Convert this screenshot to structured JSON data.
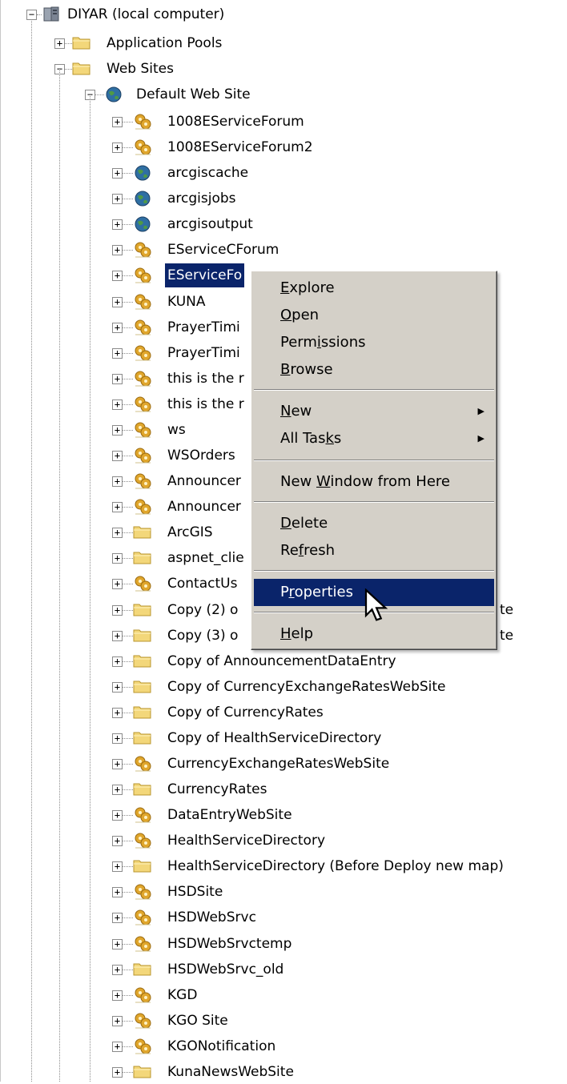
{
  "tree": {
    "root": {
      "label": "DIYAR (local computer)",
      "icon": "server-icon"
    },
    "app_pools": {
      "label": "Application Pools",
      "icon": "folder-icon"
    },
    "web_sites": {
      "label": "Web Sites",
      "icon": "folder-icon"
    },
    "default_site": {
      "label": "Default Web Site",
      "icon": "globe-icon"
    },
    "children": [
      {
        "label": "1008EServiceForum",
        "icon": "gear-icon"
      },
      {
        "label": "1008EServiceForum2",
        "icon": "gear-icon"
      },
      {
        "label": "arcgiscache",
        "icon": "globe-icon"
      },
      {
        "label": "arcgisjobs",
        "icon": "globe-icon"
      },
      {
        "label": "arcgisoutput",
        "icon": "globe-icon"
      },
      {
        "label": "EServiceCForum",
        "icon": "gear-icon"
      },
      {
        "label": "EServiceFo",
        "icon": "gear-icon",
        "selected": true
      },
      {
        "label": "KUNA",
        "icon": "gear-icon"
      },
      {
        "label": "PrayerTimi",
        "icon": "gear-icon"
      },
      {
        "label": "PrayerTimi",
        "icon": "gear-icon"
      },
      {
        "label": "this is the r",
        "icon": "gear-icon"
      },
      {
        "label": "this is the r",
        "icon": "gear-icon"
      },
      {
        "label": "ws",
        "icon": "gear-icon"
      },
      {
        "label": "WSOrders",
        "icon": "gear-icon"
      },
      {
        "label": "Announcer",
        "icon": "gear-icon"
      },
      {
        "label": "Announcer",
        "icon": "gear-icon"
      },
      {
        "label": "ArcGIS",
        "icon": "folder-icon"
      },
      {
        "label": "aspnet_clie",
        "icon": "folder-icon"
      },
      {
        "label": "ContactUs",
        "icon": "gear-icon"
      },
      {
        "label": "Copy (2) o",
        "icon": "folder-icon",
        "tail": "te"
      },
      {
        "label": "Copy (3) o",
        "icon": "folder-icon",
        "tail": "te"
      },
      {
        "label": "Copy of AnnouncementDataEntry",
        "icon": "folder-icon"
      },
      {
        "label": "Copy of CurrencyExchangeRatesWebSite",
        "icon": "folder-icon"
      },
      {
        "label": "Copy of CurrencyRates",
        "icon": "folder-icon"
      },
      {
        "label": "Copy of HealthServiceDirectory",
        "icon": "folder-icon"
      },
      {
        "label": "CurrencyExchangeRatesWebSite",
        "icon": "gear-icon"
      },
      {
        "label": "CurrencyRates",
        "icon": "folder-icon"
      },
      {
        "label": "DataEntryWebSite",
        "icon": "gear-icon"
      },
      {
        "label": "HealthServiceDirectory",
        "icon": "gear-icon"
      },
      {
        "label": "HealthServiceDirectory (Before Deploy new map)",
        "icon": "folder-icon"
      },
      {
        "label": "HSDSite",
        "icon": "gear-icon"
      },
      {
        "label": "HSDWebSrvc",
        "icon": "gear-icon"
      },
      {
        "label": "HSDWebSrvctemp",
        "icon": "gear-icon"
      },
      {
        "label": "HSDWebSrvc_old",
        "icon": "folder-icon"
      },
      {
        "label": "KGD",
        "icon": "gear-icon"
      },
      {
        "label": "KGO Site",
        "icon": "gear-icon"
      },
      {
        "label": "KGONotification",
        "icon": "gear-icon"
      },
      {
        "label": "KunaNewsWebSite",
        "icon": "folder-icon"
      }
    ],
    "expander_plus": "+",
    "expander_minus": "−"
  },
  "context_menu": {
    "explore": {
      "pre": "",
      "key": "E",
      "post": "xplore"
    },
    "open": {
      "pre": "",
      "key": "O",
      "post": "pen"
    },
    "permissions": {
      "pre": "Perm",
      "key": "i",
      "post": "ssions"
    },
    "browse": {
      "pre": "",
      "key": "B",
      "post": "rowse"
    },
    "new": {
      "pre": "",
      "key": "N",
      "post": "ew"
    },
    "all_tasks": {
      "pre": "All Tas",
      "key": "k",
      "post": "s"
    },
    "new_window": {
      "pre": "New ",
      "key": "W",
      "post": "indow from Here"
    },
    "delete": {
      "pre": "",
      "key": "D",
      "post": "elete"
    },
    "refresh": {
      "pre": "Re",
      "key": "f",
      "post": "resh"
    },
    "properties": {
      "pre": "P",
      "key": "r",
      "post": "operties"
    },
    "help": {
      "pre": "",
      "key": "H",
      "post": "elp"
    },
    "submenu_arrow": "▶",
    "highlighted": "properties"
  },
  "colors": {
    "selection": "#0a246a",
    "menu_bg": "#d4d0c8",
    "folder": "#f3d77a",
    "gear": "#e0a62c",
    "globe": "#2f6fa3"
  }
}
